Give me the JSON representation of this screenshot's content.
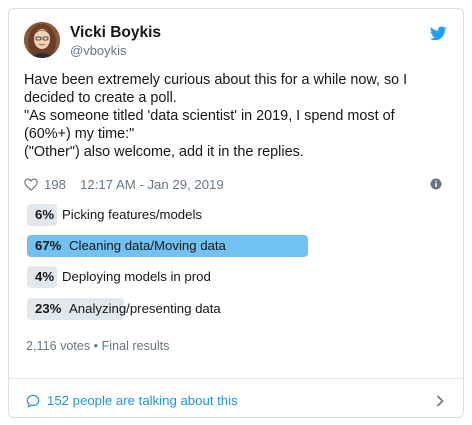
{
  "user": {
    "name": "Vicki Boykis",
    "handle": "@vboykis"
  },
  "tweet": {
    "lines": [
      "Have been extremely curious about this for a while now, so I",
      "decided to create a poll.",
      "\"As someone titled 'data scientist' in 2019, I spend most of",
      "(60%+)  my time:\"",
      "(\"Other\") also welcome, add it in the replies."
    ]
  },
  "meta": {
    "likes": "198",
    "timestamp": "12:17 AM - Jan 29, 2019"
  },
  "poll": {
    "options": [
      {
        "pct_label": "6%",
        "label": "Picking features/models",
        "value": 0.06
      },
      {
        "pct_label": "67%",
        "label": "Cleaning data/Moving data",
        "value": 0.67
      },
      {
        "pct_label": "4%",
        "label": "Deploying models in prod",
        "value": 0.04
      },
      {
        "pct_label": "23%",
        "label": "Analyzing/presenting data",
        "value": 0.23
      }
    ],
    "results": "2,116 votes • Final results"
  },
  "footer": {
    "talking": "152 people are talking about this"
  },
  "colors": {
    "twitter_blue": "#1da1f2",
    "winner_bar": "#72c2f1",
    "bar": "#e1e8ed",
    "secondary_text": "#657786",
    "link": "#1b95e0"
  },
  "icons": {
    "brand": "twitter-bird-icon",
    "like": "heart-icon",
    "info": "info-icon",
    "reply": "speech-bubble-icon",
    "next": "chevron-right-icon"
  }
}
